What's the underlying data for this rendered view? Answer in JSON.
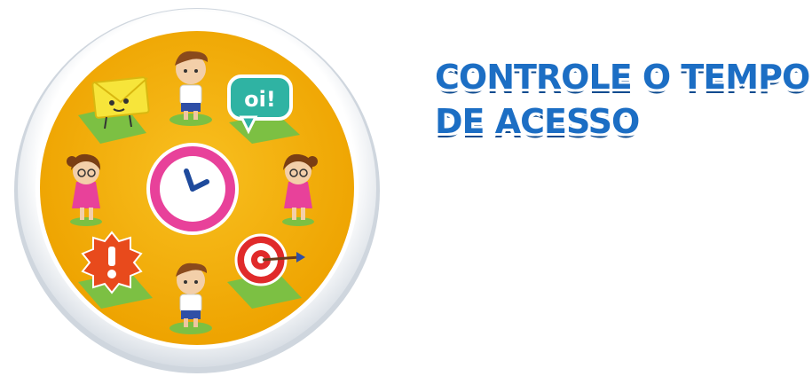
{
  "headline": {
    "line1": "CONTROLE O TEMPO",
    "line2": "DE ACESSO"
  },
  "illustration": {
    "speech_bubble_text": "oi!",
    "icons": [
      "envelope-icon",
      "boy-icon",
      "chat-bubble-icon",
      "girl-icon",
      "clock-icon",
      "alert-badge-icon",
      "target-icon"
    ]
  },
  "colors": {
    "disc": "#f4b400",
    "ring": "#e9edf2",
    "headline": "#1c6ec4",
    "clock_face": "#e8419a",
    "grass": "#7cc043"
  }
}
